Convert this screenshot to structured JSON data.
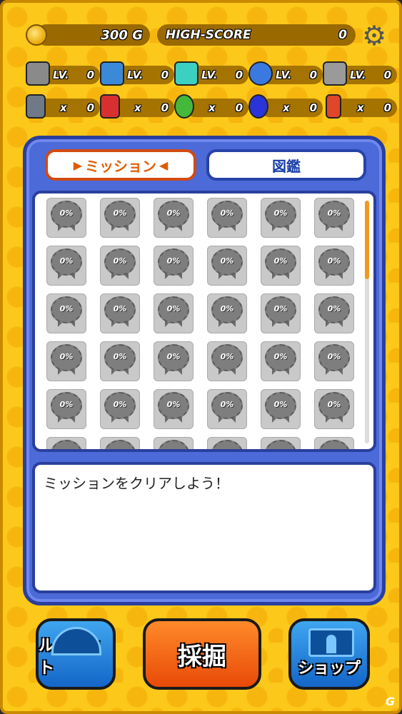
{
  "header": {
    "gold": "300 G",
    "high_score_label": "HIGH-SCORE",
    "high_score_value": "0"
  },
  "levels": [
    {
      "icon": "drill-icon",
      "label": "LV.",
      "value": "0",
      "color": "#8a8a8a"
    },
    {
      "icon": "box-icon",
      "label": "LV.",
      "value": "0",
      "color": "#3a8ad8"
    },
    {
      "icon": "crystal-device-icon",
      "label": "LV.",
      "value": "0",
      "color": "#3bd0c0"
    },
    {
      "icon": "fan-icon",
      "label": "LV.",
      "value": "0",
      "color": "#3a7ae0"
    },
    {
      "icon": "engine-icon",
      "label": "LV.",
      "value": "0",
      "color": "#9a9a9a"
    }
  ],
  "items": [
    {
      "icon": "wrench-icon",
      "label": "x",
      "value": "0",
      "color": "#707a86"
    },
    {
      "icon": "red-bag-icon",
      "label": "x",
      "value": "0",
      "color": "#d83030"
    },
    {
      "icon": "green-orb-icon",
      "label": "x",
      "value": "0",
      "color": "#44b83a"
    },
    {
      "icon": "blue-orb-icon",
      "label": "x",
      "value": "0",
      "color": "#2a34d8"
    },
    {
      "icon": "dynamite-icon",
      "label": "x",
      "value": "0",
      "color": "#e0462a"
    }
  ],
  "tabs": {
    "mission": "ミッション",
    "encyclopedia": "図鑑"
  },
  "medal_pct": "0%",
  "description": "ミッションをクリアしよう！",
  "buttons": {
    "roulette": "ルーレット",
    "mine": "採掘",
    "shop": "ショップ"
  },
  "watermark": "G"
}
